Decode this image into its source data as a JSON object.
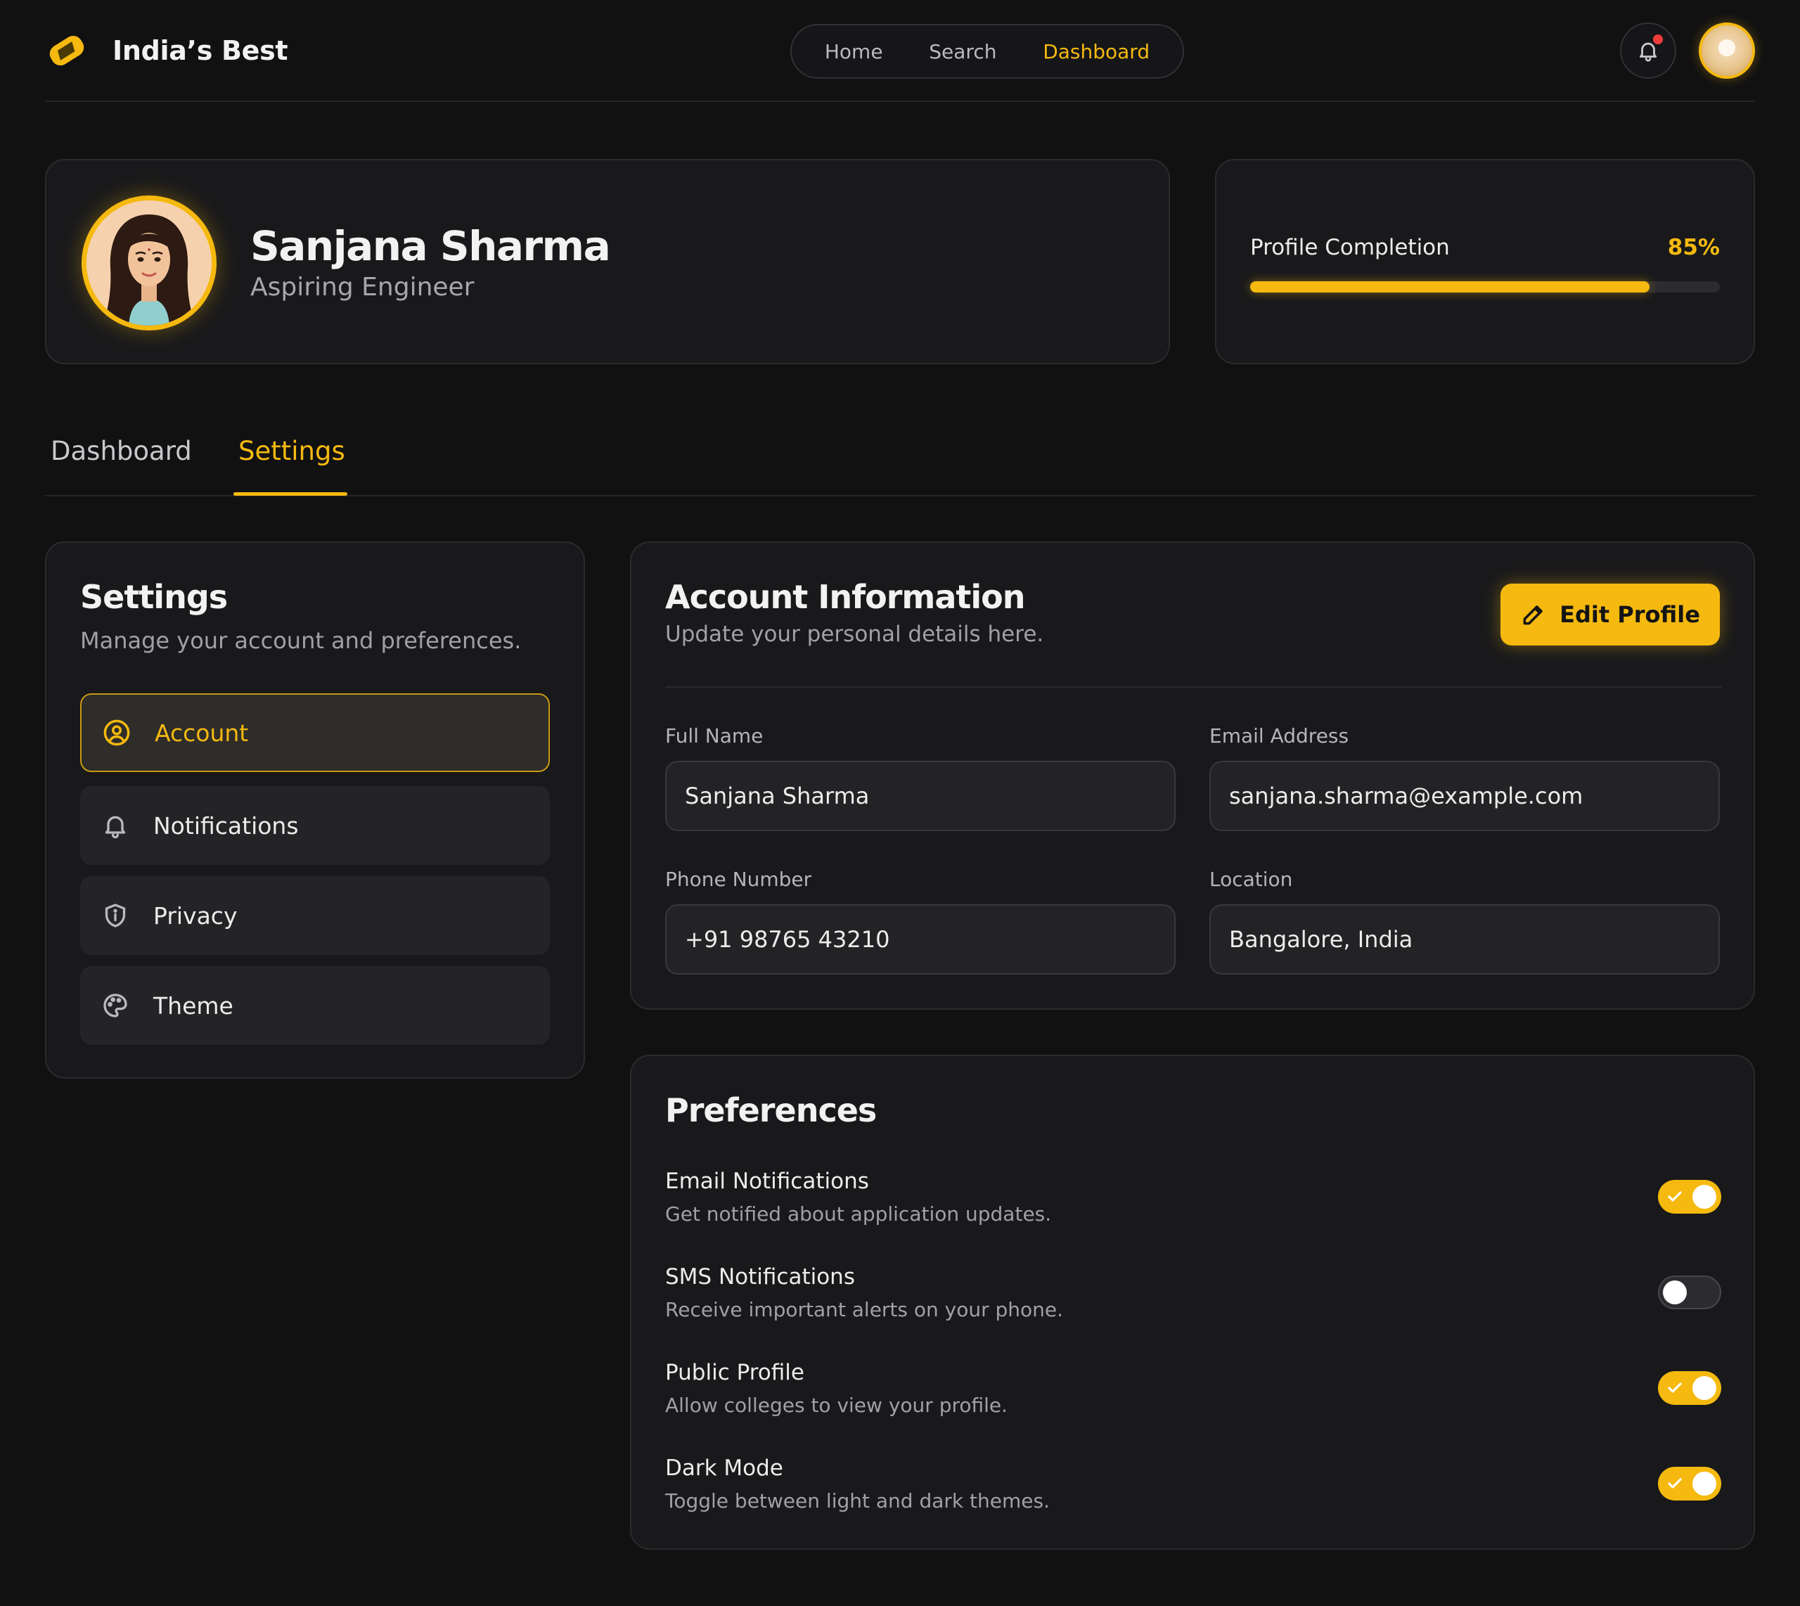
{
  "brand": {
    "name": "India’s Best",
    "accent": "#f5b90f"
  },
  "nav": {
    "links": [
      {
        "label": "Home",
        "active": false
      },
      {
        "label": "Search",
        "active": false
      },
      {
        "label": "Dashboard",
        "active": true
      }
    ],
    "notification_unread": true
  },
  "profile": {
    "name": "Sanjana Sharma",
    "role": "Aspiring Engineer"
  },
  "completion": {
    "label": "Profile Completion",
    "percent_text": "85%",
    "value": 0.85
  },
  "tabs": [
    {
      "label": "Dashboard",
      "active": false
    },
    {
      "label": "Settings",
      "active": true
    }
  ],
  "settings": {
    "title": "Settings",
    "subtitle": "Manage your account and preferences.",
    "items": [
      {
        "label": "Account",
        "icon": "user-circle-icon",
        "active": true
      },
      {
        "label": "Notifications",
        "icon": "bell-icon",
        "active": false
      },
      {
        "label": "Privacy",
        "icon": "shield-icon",
        "active": false
      },
      {
        "label": "Theme",
        "icon": "palette-icon",
        "active": false
      }
    ]
  },
  "account": {
    "title": "Account Information",
    "subtitle": "Update your personal details here.",
    "edit_label": "Edit Profile",
    "fields": {
      "full_name": {
        "label": "Full Name",
        "value": "Sanjana Sharma"
      },
      "email": {
        "label": "Email Address",
        "value": "sanjana.sharma@example.com"
      },
      "phone": {
        "label": "Phone Number",
        "value": "+91 98765 43210"
      },
      "location": {
        "label": "Location",
        "value": "Bangalore, India"
      }
    }
  },
  "preferences": {
    "title": "Preferences",
    "items": [
      {
        "title": "Email Notifications",
        "desc": "Get notified about application updates.",
        "enabled": true
      },
      {
        "title": "SMS Notifications",
        "desc": "Receive important alerts on your phone.",
        "enabled": false
      },
      {
        "title": "Public Profile",
        "desc": "Allow colleges to view your profile.",
        "enabled": true
      },
      {
        "title": "Dark Mode",
        "desc": "Toggle between light and dark themes.",
        "enabled": true
      }
    ]
  }
}
